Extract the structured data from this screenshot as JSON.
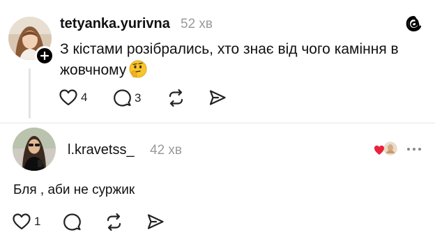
{
  "post1": {
    "username": "tetyanka.yurivna",
    "time": "52 хв",
    "text": "З кістами розібрались, хто знає від чого каміння в жовчному",
    "emoji": "thinking-face",
    "likes": "4",
    "replies": "3"
  },
  "post2": {
    "username": "l.kravetss_",
    "time": "42 хв",
    "text": "Бля , аби не суржик",
    "likes": "1"
  },
  "colors": {
    "heart": "#e8233b",
    "muted": "#9a9a9a",
    "text": "#111111"
  }
}
